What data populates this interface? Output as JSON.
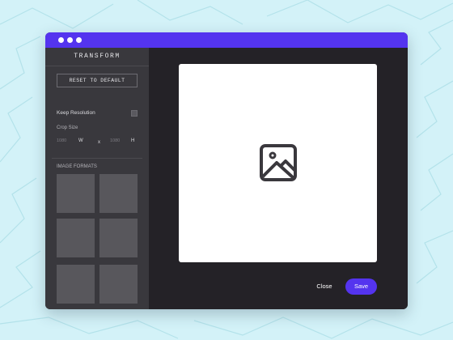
{
  "colors": {
    "accent": "#5434ef",
    "page_background": "#d3f2f8",
    "sidebar_background": "#39383d",
    "main_background": "#242227",
    "tile": "#58575c"
  },
  "titlebar": {
    "dots": [
      "window-dot",
      "window-dot",
      "window-dot"
    ]
  },
  "sidebar": {
    "title": "TRANSFORM",
    "reset_label": "RESET TO DEFAULT",
    "keep_resolution_label": "Keep Resolution",
    "keep_resolution_checked": false,
    "crop": {
      "label": "Crop Size",
      "width_placeholder": "1080",
      "width_unit": "W",
      "separator": "x",
      "height_placeholder": "1080",
      "height_unit": "H"
    },
    "formats_label": "IMAGE FORMATS",
    "format_tile_count": 6
  },
  "canvas": {
    "icon": "image-placeholder-icon"
  },
  "actions": {
    "close_label": "Close",
    "save_label": "Save"
  }
}
